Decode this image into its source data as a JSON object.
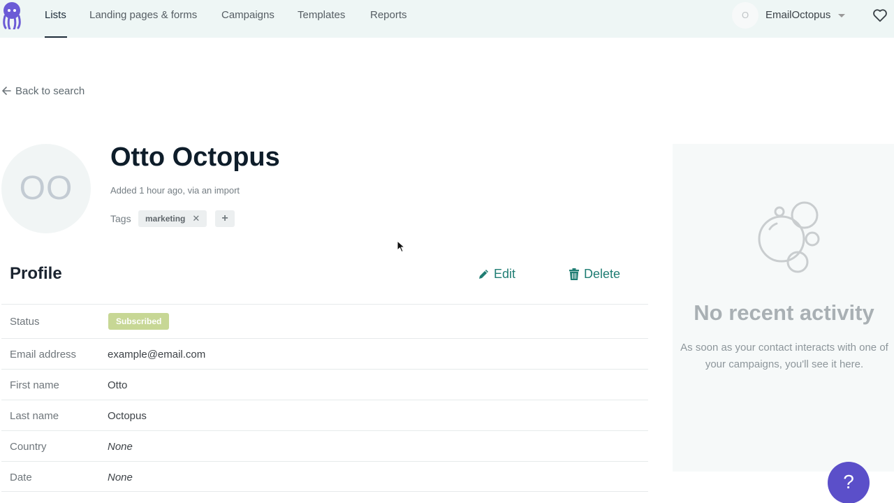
{
  "nav": {
    "items": [
      "Lists",
      "Landing pages & forms",
      "Campaigns",
      "Templates",
      "Reports"
    ],
    "active": "Lists",
    "account_initial": "O",
    "account_name": "EmailOctopus"
  },
  "back_label": "Back to search",
  "contact": {
    "initials": "OO",
    "name": "Otto Octopus",
    "added": "Added 1 hour ago, via an import",
    "tags_label": "Tags",
    "tags": [
      "marketing"
    ],
    "tag_remove_glyph": "✕",
    "tag_add_glyph": "+"
  },
  "profile": {
    "title": "Profile",
    "edit_label": "Edit",
    "delete_label": "Delete",
    "status_label": "Status",
    "status_value": "Subscribed",
    "fields": [
      {
        "label": "Email address",
        "value": "example@email.com"
      },
      {
        "label": "First name",
        "value": "Otto"
      },
      {
        "label": "Last name",
        "value": "Octopus"
      },
      {
        "label": "Country",
        "value": "None"
      },
      {
        "label": "Date",
        "value": "None"
      }
    ]
  },
  "activity": {
    "title": "No recent activity",
    "text": "As soon as your contact interacts with one of your campaigns, you'll see it here."
  },
  "help_label": "?",
  "colors": {
    "brand": "#5b4fc9",
    "link": "#1f7d73",
    "badge": "#c7d795",
    "nav_bg": "#eef6f5"
  }
}
